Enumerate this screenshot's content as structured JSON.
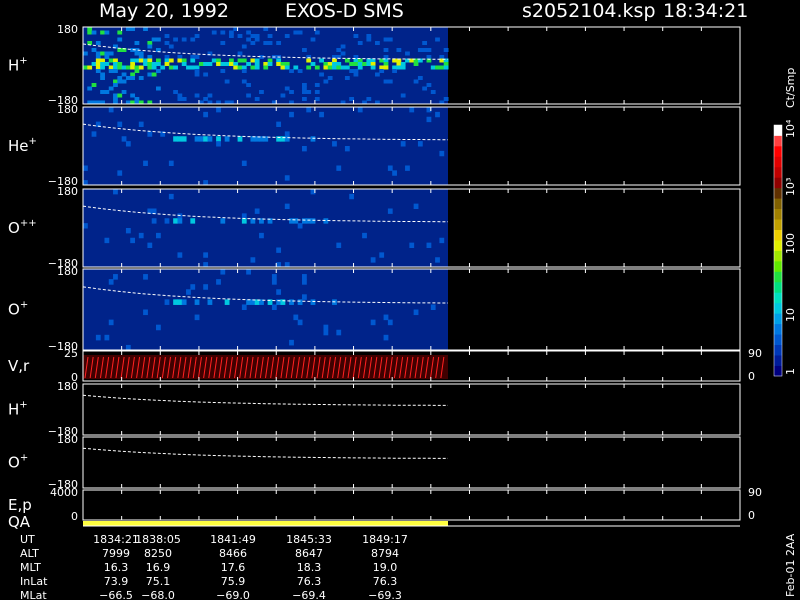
{
  "header": {
    "date": "May 20, 1992",
    "instrument": "EXOS-D SMS",
    "file": "s2052104.ksp",
    "time": "18:34:21"
  },
  "colorbar": {
    "unit": "Ct/Smp",
    "labels": [
      "1",
      "10",
      "100",
      "10³",
      "10⁴"
    ],
    "colors": [
      "#000080",
      "#001c9a",
      "#0038b8",
      "#0058d0",
      "#0078e0",
      "#00a0e8",
      "#00c8e0",
      "#00e0c0",
      "#00e080",
      "#20e040",
      "#60e800",
      "#a0e800",
      "#e0f000",
      "#f0d000",
      "#c0a000",
      "#a08000",
      "#806000",
      "#603000",
      "#900000",
      "#c00000",
      "#e00000",
      "#ff0000",
      "#ff4040",
      "#ffffff"
    ]
  },
  "panels": [
    {
      "id": "h-plus",
      "label": "H",
      "sup": "+",
      "ymax": "180",
      "ymin": "−180"
    },
    {
      "id": "he-plus",
      "label": "He",
      "sup": "+",
      "ymax": "180",
      "ymin": "−180"
    },
    {
      "id": "o-plusplus",
      "label": "O",
      "sup": "++",
      "ymax": "180",
      "ymin": "−180"
    },
    {
      "id": "o-plus",
      "label": "O",
      "sup": "+",
      "ymax": "180",
      "ymin": "−180"
    },
    {
      "id": "vr",
      "label": "V,r",
      "sup": "",
      "ymax": "25",
      "ymin": "0",
      "rmax": "90",
      "rmin": "0"
    },
    {
      "id": "h-plus-2",
      "label": "H",
      "sup": "+",
      "ymax": "180",
      "ymin": "−180"
    },
    {
      "id": "o-plus-2",
      "label": "O",
      "sup": "+",
      "ymax": "180",
      "ymin": "−180"
    },
    {
      "id": "ep",
      "label": "E,p",
      "sup": "",
      "ymax": "4000",
      "ymin": "0",
      "rmax": "90",
      "rmin": "0"
    }
  ],
  "qa_label": "QA",
  "footer": {
    "rows": [
      {
        "label": "UT",
        "values": [
          "1834:21",
          "1838:05",
          "1841:49",
          "1845:33",
          "1849:17"
        ]
      },
      {
        "label": "ALT",
        "values": [
          "7999",
          "8250",
          "8466",
          "8647",
          "8794"
        ]
      },
      {
        "label": "MLT",
        "values": [
          "16.3",
          "16.9",
          "17.6",
          "18.3",
          "19.0"
        ]
      },
      {
        "label": "InLat",
        "values": [
          "73.9",
          "75.1",
          "75.9",
          "76.3",
          "76.3"
        ]
      },
      {
        "label": "MLat",
        "values": [
          "−66.5",
          "−68.0",
          "−69.0",
          "−69.4",
          "−69.3"
        ]
      }
    ],
    "side_note": "Feb-01 2AA"
  },
  "chart_data": {
    "type": "heatmap",
    "title": "May 20, 1992   EXOS-D SMS",
    "x_ticks": [
      "1834:21",
      "1838:05",
      "1841:49",
      "1845:33",
      "1849:17"
    ],
    "colorbar_unit": "Ct/Smp",
    "colorbar_ticks": [
      "1",
      "10",
      "100",
      "10³",
      "10⁴"
    ],
    "panels": [
      {
        "name": "H+",
        "ylim": [
          -180,
          180
        ],
        "data_coverage_fraction": 0.5
      },
      {
        "name": "He+",
        "ylim": [
          -180,
          180
        ],
        "data_coverage_fraction": 0.5
      },
      {
        "name": "O++",
        "ylim": [
          -180,
          180
        ],
        "data_coverage_fraction": 0.5
      },
      {
        "name": "O+",
        "ylim": [
          -180,
          180
        ],
        "data_coverage_fraction": 0.5
      },
      {
        "name": "V,r",
        "ylim": [
          0,
          25
        ],
        "right_ylim": [
          0,
          90
        ]
      },
      {
        "name": "H+",
        "ylim": [
          -180,
          180
        ]
      },
      {
        "name": "O+",
        "ylim": [
          -180,
          180
        ]
      },
      {
        "name": "E,p",
        "ylim": [
          0,
          4000
        ],
        "right_ylim": [
          0,
          90
        ]
      }
    ]
  }
}
